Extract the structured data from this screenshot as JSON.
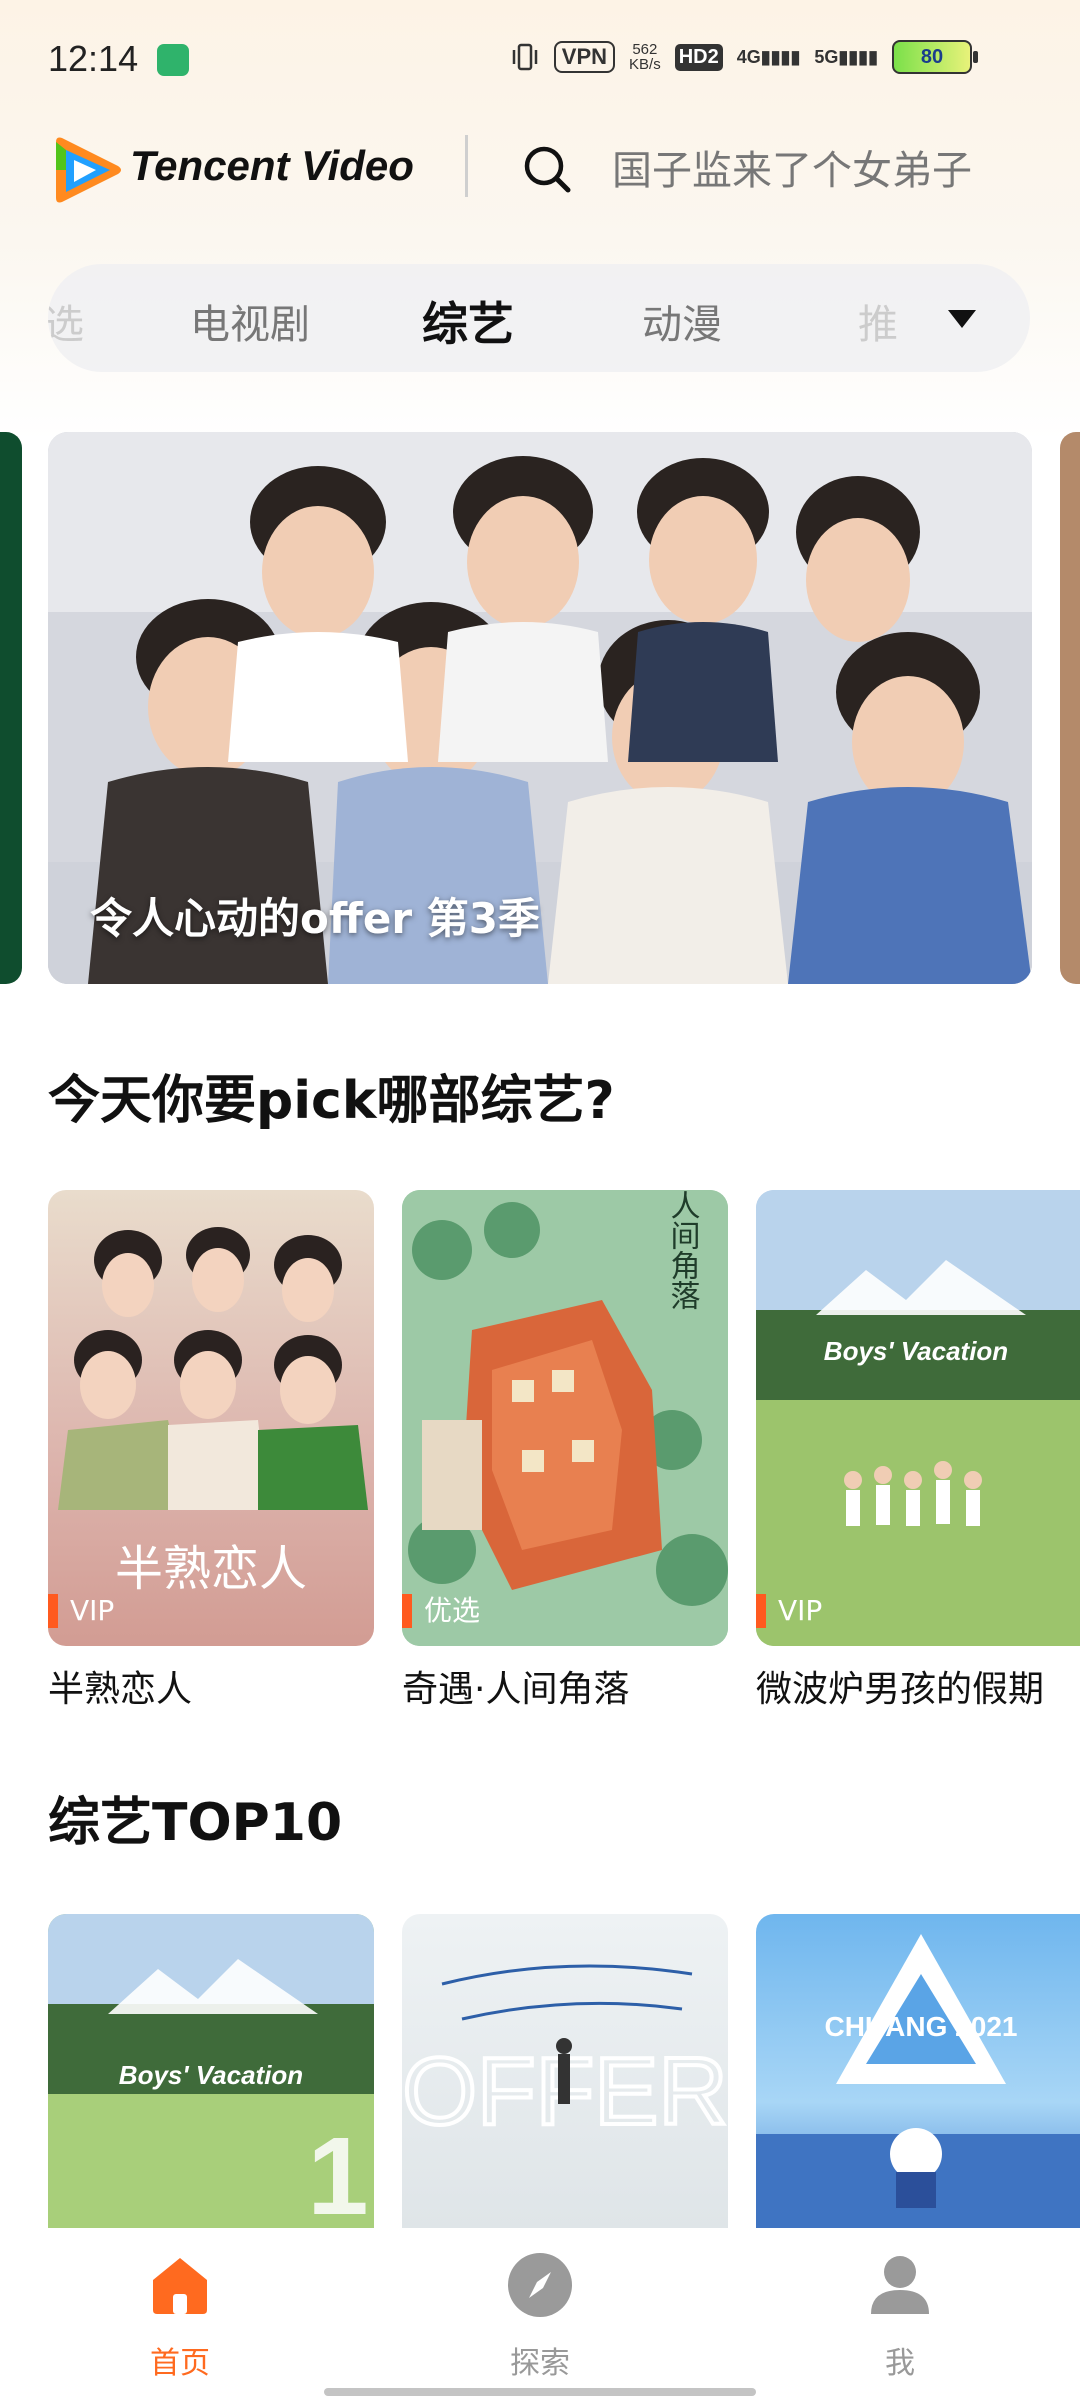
{
  "status_bar": {
    "time": "12:14",
    "vpn": "VPN",
    "speed_value": "562",
    "speed_unit": "KB/s",
    "hd": "HD2",
    "sig1": "4G",
    "sig2": "5G",
    "battery": "80"
  },
  "header": {
    "logo_text": "Tencent Video",
    "search_placeholder": "国子监来了个女弟子"
  },
  "tabs": [
    {
      "label": "选",
      "state": "faded"
    },
    {
      "label": "电视剧",
      "state": "normal"
    },
    {
      "label": "综艺",
      "state": "active"
    },
    {
      "label": "动漫",
      "state": "normal"
    },
    {
      "label": "推",
      "state": "faded"
    }
  ],
  "banner": {
    "title": "令人心动的offer 第3季"
  },
  "section1": {
    "title": "今天你要pick哪部综艺?",
    "cards": [
      {
        "title": "半熟恋人",
        "badge": "VIP",
        "poster_text": "半熟恋人"
      },
      {
        "title": "奇遇·人间角落",
        "badge": "优选",
        "poster_text": "人间角落"
      },
      {
        "title": "微波炉男孩的假期",
        "badge": "VIP",
        "poster_text": "Boys' Vacation"
      }
    ]
  },
  "section2": {
    "title": "综艺TOP10",
    "cards": [
      {
        "poster_text": "Boys' Vacation"
      },
      {
        "poster_text": "OFFER"
      },
      {
        "poster_text": "CHUANG 2021"
      }
    ]
  },
  "bottom_nav": [
    {
      "label": "首页",
      "active": true
    },
    {
      "label": "探索",
      "active": false
    },
    {
      "label": "我",
      "active": false
    }
  ],
  "colors": {
    "accent": "#ff6a1f",
    "vip_bar": "#ff5a1f"
  }
}
